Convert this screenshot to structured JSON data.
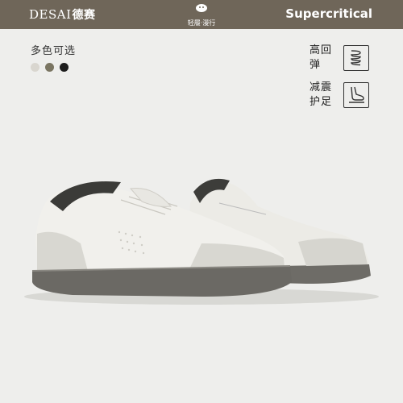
{
  "header": {
    "brand_latin": "DESAI",
    "brand_cn": "德赛",
    "center_tag": "轻履·漫行",
    "partner": "Supercritical"
  },
  "colors": {
    "label": "多色可选",
    "swatches": [
      "#d9d6cf",
      "#7a7562",
      "#1d1d1d"
    ]
  },
  "features": [
    {
      "label": "高回弹",
      "icon": "spring-coil-icon"
    },
    {
      "label": "减震护足",
      "icon": "foot-cushion-icon"
    }
  ],
  "theme": {
    "header_bg": "#6f6659",
    "page_bg": "#eeeeec"
  }
}
